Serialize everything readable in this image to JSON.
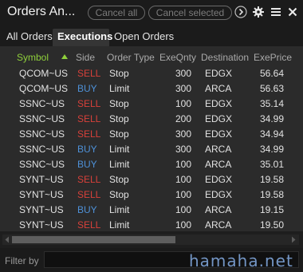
{
  "window": {
    "title": "Orders An...",
    "cancel_all_label": "Cancel all",
    "cancel_selected_label": "Cancel selected",
    "icons": [
      "chevron-right-icon",
      "gear-icon",
      "menu-icon",
      "close-icon"
    ]
  },
  "tabs": [
    {
      "label": "All Orders",
      "active": false
    },
    {
      "label": "Executions",
      "active": true
    },
    {
      "label": "Open Orders",
      "active": false
    }
  ],
  "table": {
    "columns": [
      "Symbol",
      "Side",
      "Order Type",
      "ExeQnty",
      "Destination",
      "ExePrice"
    ],
    "sort": {
      "column": "Symbol",
      "direction": "ascending"
    },
    "rows": [
      {
        "symbol": "QCOM~US",
        "side": "SELL",
        "type": "Stop",
        "qty": "300",
        "dest": "EDGX",
        "price": "56.64"
      },
      {
        "symbol": "QCOM~US",
        "side": "BUY",
        "type": "Limit",
        "qty": "300",
        "dest": "ARCA",
        "price": "56.63"
      },
      {
        "symbol": "SSNC~US",
        "side": "SELL",
        "type": "Stop",
        "qty": "100",
        "dest": "EDGX",
        "price": "35.14"
      },
      {
        "symbol": "SSNC~US",
        "side": "SELL",
        "type": "Stop",
        "qty": "200",
        "dest": "EDGX",
        "price": "34.99"
      },
      {
        "symbol": "SSNC~US",
        "side": "SELL",
        "type": "Stop",
        "qty": "300",
        "dest": "EDGX",
        "price": "34.94"
      },
      {
        "symbol": "SSNC~US",
        "side": "BUY",
        "type": "Limit",
        "qty": "300",
        "dest": "ARCA",
        "price": "34.99"
      },
      {
        "symbol": "SSNC~US",
        "side": "BUY",
        "type": "Limit",
        "qty": "100",
        "dest": "ARCA",
        "price": "35.01"
      },
      {
        "symbol": "SYNT~US",
        "side": "SELL",
        "type": "Stop",
        "qty": "100",
        "dest": "EDGX",
        "price": "19.58"
      },
      {
        "symbol": "SYNT~US",
        "side": "SELL",
        "type": "Stop",
        "qty": "100",
        "dest": "EDGX",
        "price": "19.58"
      },
      {
        "symbol": "SYNT~US",
        "side": "BUY",
        "type": "Limit",
        "qty": "100",
        "dest": "ARCA",
        "price": "19.15"
      },
      {
        "symbol": "SYNT~US",
        "side": "SELL",
        "type": "Limit",
        "qty": "100",
        "dest": "ARCA",
        "price": "19.50"
      }
    ]
  },
  "filter": {
    "label": "Filter by",
    "value": ""
  },
  "watermark": "hamaha.net",
  "colors": {
    "accent": "#8fd03b",
    "sell": "#d7403a",
    "buy": "#4e91d8"
  }
}
